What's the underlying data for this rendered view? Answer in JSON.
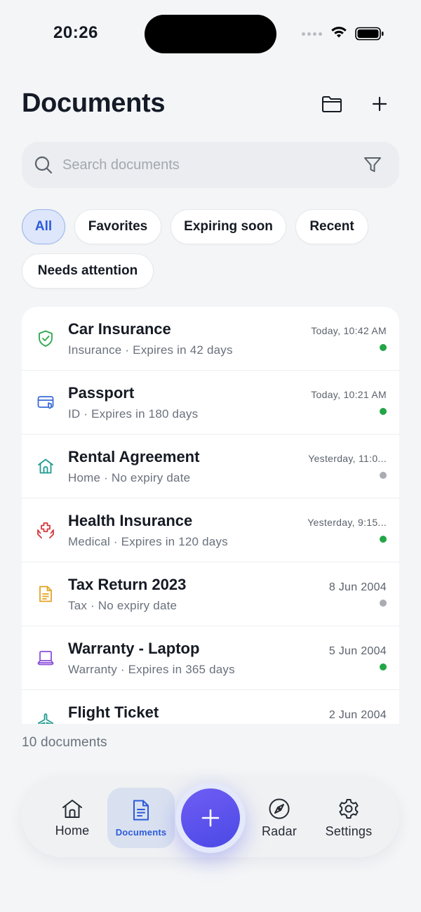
{
  "status": {
    "time": "20:26"
  },
  "header": {
    "title": "Documents"
  },
  "search": {
    "placeholder": "Search documents",
    "value": ""
  },
  "chips": [
    {
      "label": "All",
      "active": true
    },
    {
      "label": "Favorites"
    },
    {
      "label": "Expiring soon"
    },
    {
      "label": "Recent"
    },
    {
      "label": "Needs attention"
    }
  ],
  "documents": [
    {
      "name": "Car Insurance",
      "subtitle": "Insurance · Expires in 42 days",
      "date": "Today, 10:42 AM",
      "icon": "shield-check-icon",
      "icon_color": "#2aa84a",
      "status_color": "#22a647"
    },
    {
      "name": "Passport",
      "subtitle": "ID · Expires in 180 days",
      "date": "Today, 10:21 AM",
      "icon": "id-card-icon",
      "icon_color": "#3a6bd8",
      "status_color": "#22a647"
    },
    {
      "name": "Rental Agreement",
      "subtitle": "Home · No expiry date",
      "date": "Yesterday, 11:0...",
      "icon": "home-icon",
      "icon_color": "#1f9b8f",
      "status_color": "#a9acb2"
    },
    {
      "name": "Health Insurance",
      "subtitle": "Medical · Expires in 120 days",
      "date": "Yesterday, 9:15...",
      "icon": "medical-hands-icon",
      "icon_color": "#d8363a",
      "status_color": "#22a647"
    },
    {
      "name": "Tax Return 2023",
      "subtitle": "Tax · No expiry date",
      "date": "8 Jun 2004",
      "icon": "document-icon",
      "icon_color": "#e3a421",
      "status_color": "#a9acb2"
    },
    {
      "name": "Warranty - Laptop",
      "subtitle": "Warranty · Expires in 365 days",
      "date": "5 Jun 2004",
      "icon": "laptop-icon",
      "icon_color": "#8a4fd9",
      "status_color": "#22a647"
    },
    {
      "name": "Flight Ticket",
      "subtitle": "",
      "date": "2 Jun 2004",
      "icon": "airplane-icon",
      "icon_color": "#1f9b8f",
      "status_color": ""
    }
  ],
  "footer": {
    "count": "10 documents"
  },
  "tabbar": {
    "home": "Home",
    "documents": "Documents",
    "radar": "Radar",
    "settings": "Settings"
  },
  "colors": {
    "accent": "#2d5ad9",
    "fab": "#5a52ec"
  }
}
